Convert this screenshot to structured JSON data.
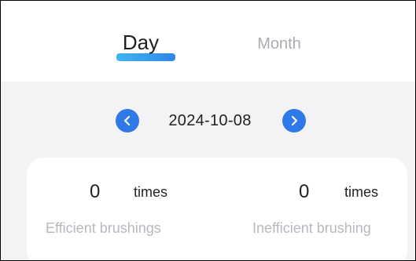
{
  "tabs": {
    "day_label": "Day",
    "month_label": "Month",
    "active": "Day",
    "accent_colors": [
      "#3fb6f0",
      "#2f86e8"
    ]
  },
  "date_nav": {
    "date": "2024-10-08",
    "prev_icon": "chevron-left-icon",
    "next_icon": "chevron-right-icon",
    "button_color": "#2f78e8"
  },
  "stats": {
    "efficient": {
      "value": "0",
      "unit": "times",
      "label": "Efficient brushings"
    },
    "inefficient": {
      "value": "0",
      "unit": "times",
      "label": "Inefficient brushing"
    }
  }
}
